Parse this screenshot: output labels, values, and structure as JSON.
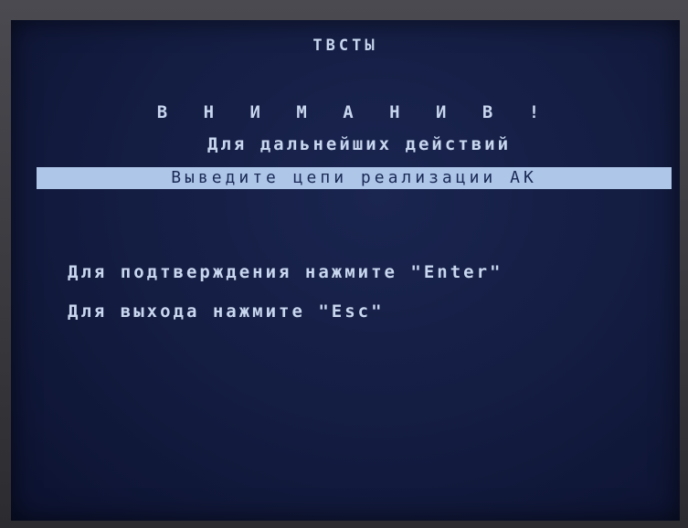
{
  "screen": {
    "title": "ТВСТЫ",
    "attention": "В Н И М А Н И В !",
    "subtitle": "Для дальнейших действий",
    "highlight": "Выведите цепи реализации АК",
    "confirm_hint": "Для подтверждения нажмите \"Enter\"",
    "exit_hint": "Для выхода нажмите \"Esc\""
  },
  "colors": {
    "background": "#131c40",
    "text": "#c9d6ef",
    "highlight_bar": "#aec6e8",
    "highlight_text": "#1a2a55"
  }
}
